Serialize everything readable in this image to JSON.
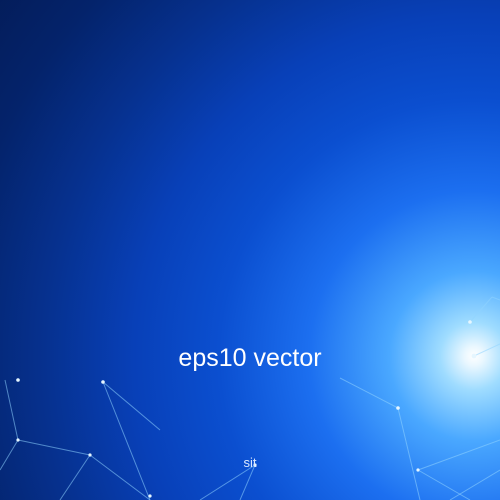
{
  "image": {
    "headline": "eps10 vector",
    "caption": "sit"
  },
  "colors": {
    "background_dark": "#031b55",
    "background_mid": "#0b4fd0",
    "glow_center": "#ffffff",
    "line_color": "#8fd4ff",
    "text_color": "#ffffff"
  }
}
